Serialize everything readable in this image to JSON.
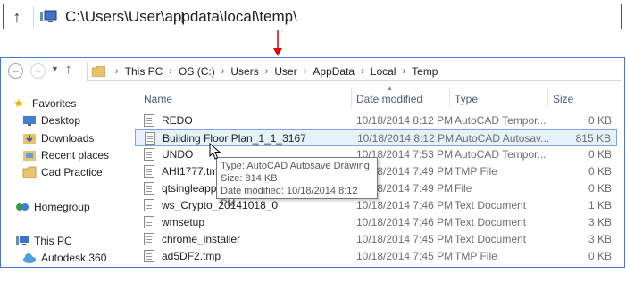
{
  "top_bar": {
    "path": "C:\\Users\\User\\appdata\\local\\temp\\"
  },
  "explorer": {
    "breadcrumb": [
      "This PC",
      "OS (C:)",
      "Users",
      "User",
      "AppData",
      "Local",
      "Temp"
    ],
    "sidebar": [
      {
        "label": "Favorites",
        "icon": "star-icon"
      },
      {
        "label": "Desktop",
        "icon": "desktop-icon"
      },
      {
        "label": "Downloads",
        "icon": "downloads-icon"
      },
      {
        "label": "Recent places",
        "icon": "recent-places-icon"
      },
      {
        "label": "Cad Practice",
        "icon": "folder-icon"
      },
      {
        "label": "Homegroup",
        "icon": "homegroup-icon"
      },
      {
        "label": "This PC",
        "icon": "computer-icon"
      },
      {
        "label": "Autodesk 360",
        "icon": "cloud-icon"
      }
    ],
    "columns": {
      "name": "Name",
      "date": "Date modified",
      "type": "Type",
      "size": "Size"
    },
    "files": [
      {
        "name": "REDO",
        "date": "10/18/2014 8:12 PM",
        "type": "AutoCAD Tempor...",
        "size": "0 KB"
      },
      {
        "name": "Building Floor Plan_1_1_3167",
        "date": "10/18/2014 8:12 PM",
        "type": "AutoCAD Autosav...",
        "size": "815 KB"
      },
      {
        "name": "UNDO",
        "date": "10/18/2014 7:53 PM",
        "type": "AutoCAD Tempor...",
        "size": "0 KB"
      },
      {
        "name": "AHI1777.tmp",
        "date": "10/18/2014 7:49 PM",
        "type": "TMP File",
        "size": "0 KB"
      },
      {
        "name": "qtsingleapp-...",
        "date": "10/18/2014 7:49 PM",
        "type": "File",
        "size": "0 KB"
      },
      {
        "name": "ws_Crypto_20141018_0",
        "date": "10/18/2014 7:46 PM",
        "type": "Text Document",
        "size": "1 KB"
      },
      {
        "name": "wmsetup",
        "date": "10/18/2014 7:46 PM",
        "type": "Text Document",
        "size": "3 KB"
      },
      {
        "name": "chrome_installer",
        "date": "10/18/2014 7:45 PM",
        "type": "Text Document",
        "size": "3 KB"
      },
      {
        "name": "ad5DF2.tmp",
        "date": "10/18/2014 7:45 PM",
        "type": "TMP File",
        "size": "0 KB"
      }
    ],
    "tooltip": {
      "type_line": "Type: AutoCAD Autosave Drawing",
      "size_line": "Size: 814 KB",
      "date_line": "Date modified: 10/18/2014 8:12 PM"
    }
  },
  "colors": {
    "selection": "#e5f1fb",
    "accent_blue": "#2e4fd6",
    "arrow_red": "#e00000"
  }
}
